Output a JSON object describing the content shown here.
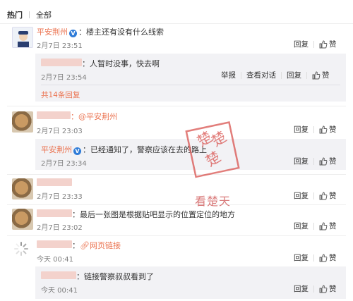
{
  "tabs": [
    {
      "label": "热门",
      "active": true
    },
    {
      "label": "全部",
      "active": false
    }
  ],
  "comments": [
    {
      "user": "平安荆州",
      "text": "：楼主还有没有什么线索",
      "time": "2月7日 23:51",
      "actions": {
        "reply": "回复",
        "like": "赞"
      },
      "replies": [
        {
          "text": "：人暂时没事，快去啊",
          "time": "2月7日 23:54",
          "actions": {
            "report": "举报",
            "view_conversation": "查看对话",
            "reply": "回复",
            "like": "赞"
          }
        }
      ],
      "more_replies": "共14条回复"
    },
    {
      "mention": "：@平安荆州",
      "time": "2月7日 23:03",
      "actions": {
        "reply": "回复",
        "like": "赞"
      },
      "reply": {
        "user": "平安荆州",
        "text": "：已经通知了，警察应该在去的路上",
        "time": "2月7日 23:34",
        "actions": {
          "reply": "回复",
          "like": "赞"
        }
      }
    },
    {
      "time": "2月7日 23:33",
      "actions": {
        "reply": "回复",
        "like": "赞"
      }
    },
    {
      "text": "：最后一张图是根据贴吧显示的位置定位的地方",
      "time": "2月7日 23:02",
      "actions": {
        "reply": "回复",
        "like": "赞"
      }
    },
    {
      "link_text": "网页链接",
      "time": "今天 00:41",
      "actions": {
        "reply": "回复",
        "like": "赞"
      },
      "reply": {
        "text": "：链接警察叔叔看到了",
        "time": "今天 00:41",
        "actions": {
          "reply": "回复",
          "like": "赞"
        }
      }
    }
  ],
  "watermark": {
    "stamp": "楚",
    "site_name": "看楚天"
  },
  "colors": {
    "link": "#eb7350",
    "time": "#808080",
    "subbox": "#f2f2f5"
  }
}
